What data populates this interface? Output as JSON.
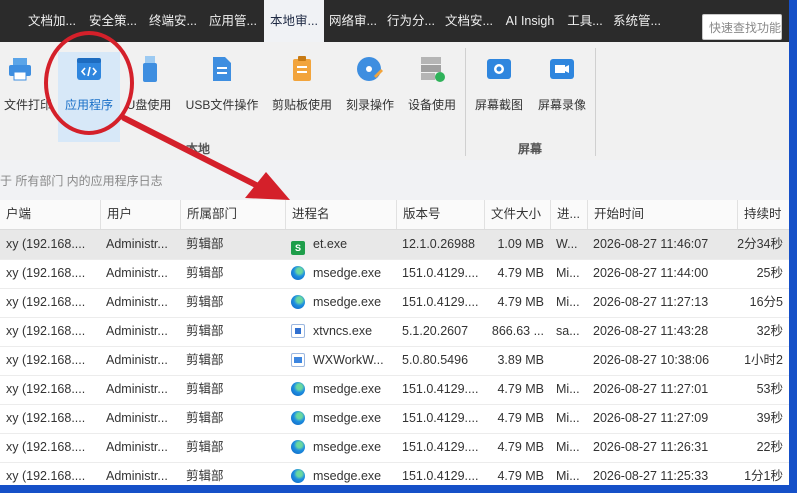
{
  "menubar": {
    "items": [
      {
        "label": "文档加...",
        "active": false
      },
      {
        "label": "安全策...",
        "active": false
      },
      {
        "label": "终端安...",
        "active": false
      },
      {
        "label": "应用管...",
        "active": false
      },
      {
        "label": "本地审...",
        "active": true
      },
      {
        "label": "网络审...",
        "active": false
      },
      {
        "label": "行为分...",
        "active": false
      },
      {
        "label": "文档安...",
        "active": false
      },
      {
        "label": "AI Insigh",
        "active": false
      },
      {
        "label": "工具...",
        "active": false
      },
      {
        "label": "系统管...",
        "active": false
      }
    ],
    "search_placeholder": "快速查找功能"
  },
  "ribbon": {
    "buttons": [
      {
        "label": "文件打印",
        "icon": "printer-icon"
      },
      {
        "label": "应用程序",
        "icon": "code-window-icon",
        "selected": true
      },
      {
        "label": "U盘使用",
        "icon": "usb-drive-icon"
      },
      {
        "label": "USB文件操作",
        "icon": "usb-file-icon"
      },
      {
        "label": "剪贴板使用",
        "icon": "clipboard-icon"
      },
      {
        "label": "刻录操作",
        "icon": "disc-burn-icon"
      },
      {
        "label": "设备使用",
        "icon": "device-icon"
      },
      {
        "label": "屏幕截图",
        "icon": "camera-icon"
      },
      {
        "label": "屏幕录像",
        "icon": "video-camera-icon"
      }
    ],
    "groups": [
      {
        "label": "本地"
      },
      {
        "label": "屏幕"
      }
    ]
  },
  "breadcrumb": "于 所有部门 内的应用程序日志",
  "table": {
    "columns": [
      "户端",
      "用户",
      "所属部门",
      "进程名",
      "版本号",
      "文件大小",
      "进...",
      "开始时间",
      "持续时"
    ],
    "rows": [
      {
        "client": "xy (192.168....",
        "user": "Administr...",
        "dept": "剪辑部",
        "process": "et.exe",
        "icon": "et",
        "version": "12.1.0.26988",
        "size": "1.09 MB",
        "proc2": "W...",
        "start": "2026-08-27 11:46:07",
        "duration": "2分34秒",
        "selected": true
      },
      {
        "client": "xy (192.168....",
        "user": "Administr...",
        "dept": "剪辑部",
        "process": "msedge.exe",
        "icon": "edge",
        "version": "151.0.4129....",
        "size": "4.79 MB",
        "proc2": "Mi...",
        "start": "2026-08-27 11:44:00",
        "duration": "25秒"
      },
      {
        "client": "xy (192.168....",
        "user": "Administr...",
        "dept": "剪辑部",
        "process": "msedge.exe",
        "icon": "edge",
        "version": "151.0.4129....",
        "size": "4.79 MB",
        "proc2": "Mi...",
        "start": "2026-08-27 11:27:13",
        "duration": "16分5"
      },
      {
        "client": "xy (192.168....",
        "user": "Administr...",
        "dept": "剪辑部",
        "process": "xtvncs.exe",
        "icon": "xtv",
        "version": "5.1.20.2607",
        "size": "866.63 ...",
        "proc2": "sa...",
        "start": "2026-08-27 11:43:28",
        "duration": "32秒"
      },
      {
        "client": "xy (192.168....",
        "user": "Administr...",
        "dept": "剪辑部",
        "process": "WXWorkW...",
        "icon": "wx",
        "version": "5.0.80.5496",
        "size": "3.89 MB",
        "proc2": "",
        "start": "2026-08-27 10:38:06",
        "duration": "1小时2"
      },
      {
        "client": "xy (192.168....",
        "user": "Administr...",
        "dept": "剪辑部",
        "process": "msedge.exe",
        "icon": "edge",
        "version": "151.0.4129....",
        "size": "4.79 MB",
        "proc2": "Mi...",
        "start": "2026-08-27 11:27:01",
        "duration": "53秒"
      },
      {
        "client": "xy (192.168....",
        "user": "Administr...",
        "dept": "剪辑部",
        "process": "msedge.exe",
        "icon": "edge",
        "version": "151.0.4129....",
        "size": "4.79 MB",
        "proc2": "Mi...",
        "start": "2026-08-27 11:27:09",
        "duration": "39秒"
      },
      {
        "client": "xy (192.168....",
        "user": "Administr...",
        "dept": "剪辑部",
        "process": "msedge.exe",
        "icon": "edge",
        "version": "151.0.4129....",
        "size": "4.79 MB",
        "proc2": "Mi...",
        "start": "2026-08-27 11:26:31",
        "duration": "22秒"
      },
      {
        "client": "xy (192.168....",
        "user": "Administr...",
        "dept": "剪辑部",
        "process": "msedge.exe",
        "icon": "edge",
        "version": "151.0.4129....",
        "size": "4.79 MB",
        "proc2": "Mi...",
        "start": "2026-08-27 11:25:33",
        "duration": "1分1秒"
      }
    ]
  },
  "colors": {
    "menubar_bg": "#2b2b2b",
    "accent_blue": "#1a70c8",
    "annotation_red": "#d4202a",
    "frame_blue": "#1550c8"
  }
}
